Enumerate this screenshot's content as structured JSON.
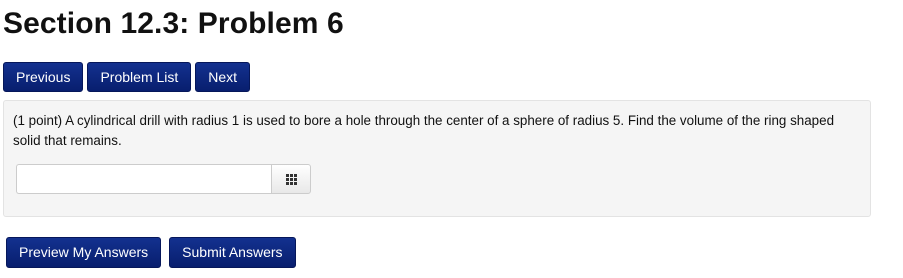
{
  "page": {
    "title": "Section 12.3: Problem 6"
  },
  "nav": {
    "previous_label": "Previous",
    "problem_list_label": "Problem List",
    "next_label": "Next"
  },
  "problem": {
    "text": "(1 point) A cylindrical drill with radius 1 is used to bore a hole through the center of a sphere of radius 5. Find the volume of the ring shaped solid that remains.",
    "answer": {
      "value": "",
      "placeholder": "",
      "equation_editor_icon": "grid-icon"
    }
  },
  "actions": {
    "preview_label": "Preview My Answers",
    "submit_label": "Submit Answers"
  },
  "colors": {
    "button_bg": "#0b2580",
    "button_text": "#ffffff",
    "panel_bg": "#f5f5f5"
  }
}
